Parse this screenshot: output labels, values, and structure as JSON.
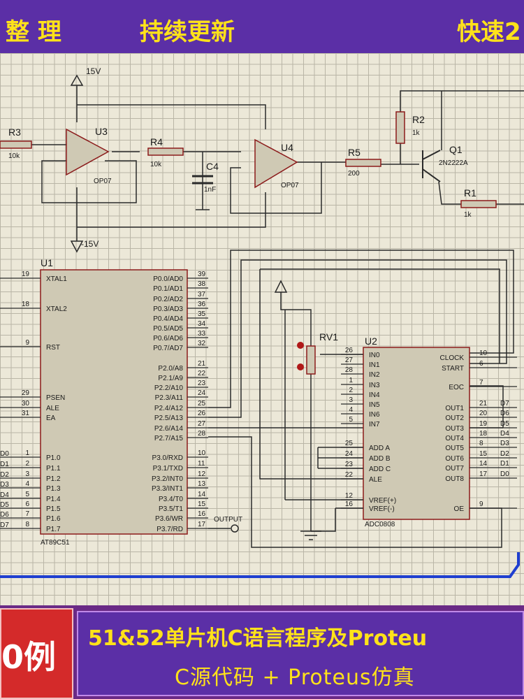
{
  "top_banner": {
    "left": "整 理",
    "center": "持续更新",
    "right": "快速2"
  },
  "schematic": {
    "supply_pos": "15V",
    "supply_neg": "-15V",
    "r3": {
      "name": "R3",
      "value": "10k"
    },
    "u3": {
      "name": "U3",
      "part": "OP07"
    },
    "r4": {
      "name": "R4",
      "value": "10k"
    },
    "c4": {
      "name": "C4",
      "value": "1nF"
    },
    "u4": {
      "name": "U4",
      "part": "OP07"
    },
    "r5": {
      "name": "R5",
      "value": "200"
    },
    "r2": {
      "name": "R2",
      "value": "1k"
    },
    "q1": {
      "name": "Q1",
      "part": "2N2222A"
    },
    "r1": {
      "name": "R1",
      "value": "1k"
    },
    "rv1": {
      "name": "RV1"
    },
    "u1": {
      "name": "U1",
      "part": "AT89C51",
      "left_pins": [
        {
          "num": "19",
          "label": "XTAL1"
        },
        {
          "num": "18",
          "label": "XTAL2"
        },
        {
          "num": "9",
          "label": "RST"
        },
        {
          "num": "29",
          "label": "PSEN"
        },
        {
          "num": "30",
          "label": "ALE"
        },
        {
          "num": "31",
          "label": "EA"
        },
        {
          "num": "1",
          "label": "P1.0",
          "net": "D0"
        },
        {
          "num": "2",
          "label": "P1.1",
          "net": "D1"
        },
        {
          "num": "3",
          "label": "P1.2",
          "net": "D2"
        },
        {
          "num": "4",
          "label": "P1.3",
          "net": "D3"
        },
        {
          "num": "5",
          "label": "P1.4",
          "net": "D4"
        },
        {
          "num": "6",
          "label": "P1.5",
          "net": "D5"
        },
        {
          "num": "7",
          "label": "P1.6",
          "net": "D6"
        },
        {
          "num": "8",
          "label": "P1.7",
          "net": "D7"
        }
      ],
      "right_pins": [
        {
          "num": "39",
          "label": "P0.0/AD0"
        },
        {
          "num": "38",
          "label": "P0.1/AD1"
        },
        {
          "num": "37",
          "label": "P0.2/AD2"
        },
        {
          "num": "36",
          "label": "P0.3/AD3"
        },
        {
          "num": "35",
          "label": "P0.4/AD4"
        },
        {
          "num": "34",
          "label": "P0.5/AD5"
        },
        {
          "num": "33",
          "label": "P0.6/AD6"
        },
        {
          "num": "32",
          "label": "P0.7/AD7"
        },
        {
          "num": "21",
          "label": "P2.0/A8"
        },
        {
          "num": "22",
          "label": "P2.1/A9"
        },
        {
          "num": "23",
          "label": "P2.2/A10"
        },
        {
          "num": "24",
          "label": "P2.3/A11"
        },
        {
          "num": "25",
          "label": "P2.4/A12"
        },
        {
          "num": "26",
          "label": "P2.5/A13"
        },
        {
          "num": "27",
          "label": "P2.6/A14"
        },
        {
          "num": "28",
          "label": "P2.7/A15"
        },
        {
          "num": "10",
          "label": "P3.0/RXD"
        },
        {
          "num": "11",
          "label": "P3.1/TXD"
        },
        {
          "num": "12",
          "label": "P3.2/INT0"
        },
        {
          "num": "13",
          "label": "P3.3/INT1"
        },
        {
          "num": "14",
          "label": "P3.4/T0"
        },
        {
          "num": "15",
          "label": "P3.5/T1"
        },
        {
          "num": "16",
          "label": "P3.6/WR"
        },
        {
          "num": "17",
          "label": "P3.7/RD"
        }
      ],
      "output_label": "OUTPUT"
    },
    "u2": {
      "name": "U2",
      "part": "ADC0808",
      "left_pins": [
        {
          "num": "26",
          "label": "IN0"
        },
        {
          "num": "27",
          "label": "IN1"
        },
        {
          "num": "28",
          "label": "IN2"
        },
        {
          "num": "1",
          "label": "IN3"
        },
        {
          "num": "2",
          "label": "IN4"
        },
        {
          "num": "3",
          "label": "IN5"
        },
        {
          "num": "4",
          "label": "IN6"
        },
        {
          "num": "5",
          "label": "IN7"
        },
        {
          "num": "25",
          "label": "ADD A"
        },
        {
          "num": "24",
          "label": "ADD B"
        },
        {
          "num": "23",
          "label": "ADD C"
        },
        {
          "num": "22",
          "label": "ALE"
        },
        {
          "num": "12",
          "label": "VREF(+)"
        },
        {
          "num": "16",
          "label": "VREF(-)"
        }
      ],
      "right_pins": [
        {
          "num": "10",
          "label": "CLOCK"
        },
        {
          "num": "6",
          "label": "START"
        },
        {
          "num": "7",
          "label": "EOC"
        },
        {
          "num": "21",
          "label": "OUT1",
          "net": "D7"
        },
        {
          "num": "20",
          "label": "OUT2",
          "net": "D6"
        },
        {
          "num": "19",
          "label": "OUT3",
          "net": "D5"
        },
        {
          "num": "18",
          "label": "OUT4",
          "net": "D4"
        },
        {
          "num": "8",
          "label": "OUT5",
          "net": "D3"
        },
        {
          "num": "15",
          "label": "OUT6",
          "net": "D2"
        },
        {
          "num": "14",
          "label": "OUT7",
          "net": "D1"
        },
        {
          "num": "17",
          "label": "OUT8",
          "net": "D0"
        },
        {
          "num": "9",
          "label": "OE"
        }
      ]
    }
  },
  "bottom_banner": {
    "badge": "0例",
    "line1": "51&52单片机C语言程序及Proteu",
    "line2": "C源代码 + Proteus仿真"
  },
  "colors": {
    "banner_bg": "#5b2fa6",
    "banner_text": "#ffe21a",
    "badge_red": "#d42a2a",
    "component_outline": "#8b1a1a",
    "wire": "#2a2a2a",
    "bus": "#1f3fd0"
  }
}
